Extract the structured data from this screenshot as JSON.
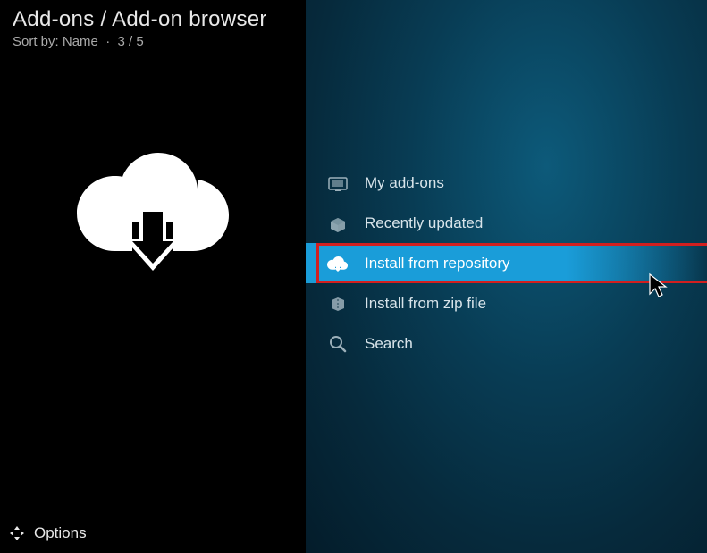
{
  "header": {
    "breadcrumb": "Add-ons / Add-on browser",
    "sort_prefix": "Sort by:",
    "sort_field": "Name",
    "position": "3 / 5"
  },
  "menu": {
    "items": [
      {
        "label": "My add-ons",
        "icon": "tv-addons-icon",
        "selected": false
      },
      {
        "label": "Recently updated",
        "icon": "box-open-icon",
        "selected": false
      },
      {
        "label": "Install from repository",
        "icon": "cloud-download-icon",
        "selected": true
      },
      {
        "label": "Install from zip file",
        "icon": "zip-file-icon",
        "selected": false
      },
      {
        "label": "Search",
        "icon": "search-icon",
        "selected": false
      }
    ]
  },
  "footer": {
    "options_label": "Options"
  },
  "colors": {
    "highlight": "#1a9dd9",
    "annotation": "#d21f1f",
    "bg_dark": "#000000"
  }
}
